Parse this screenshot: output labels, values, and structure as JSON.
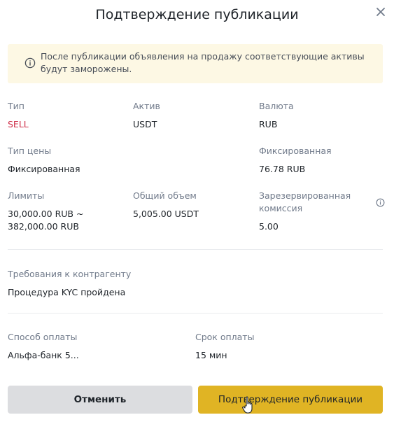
{
  "dialog": {
    "title": "Подтверждение публикации"
  },
  "notice": {
    "text": "После публикации объявления на продажу соответствующие активы будут заморожены."
  },
  "details": {
    "type_label": "Тип",
    "type_value": "SELL",
    "asset_label": "Актив",
    "asset_value": "USDT",
    "currency_label": "Валюта",
    "currency_value": "RUB",
    "price_type_label": "Тип цены",
    "price_type_value": "Фиксированная",
    "fixed_label": "Фиксированная",
    "fixed_value": "76.78 RUB",
    "limits_label": "Лимиты",
    "limits_value": "30,000.00 RUB ~ 382,000.00 RUB",
    "total_label": "Общий объем",
    "total_value": "5,005.00 USDT",
    "fee_label": "Зарезервированная комиссия",
    "fee_value": "5.00"
  },
  "requirements": {
    "label": "Требования к контрагенту",
    "value": "Процедура KYC пройдена"
  },
  "payment": {
    "method_label": "Способ оплаты",
    "method_value": "Альфа-банк 5...",
    "term_label": "Срок оплаты",
    "term_value": "15 мин"
  },
  "buttons": {
    "cancel": "Отменить",
    "confirm": "Подтверждение публикации"
  },
  "icons": {
    "close": "close-icon",
    "notice": "info-icon",
    "fee_info": "info-icon",
    "cursor": "hand-pointer-icon"
  },
  "colors": {
    "sell": "#cf304a",
    "notice_bg": "#fdf8e4",
    "confirm_bg": "#e0b424",
    "cancel_bg": "#dcdde0"
  }
}
